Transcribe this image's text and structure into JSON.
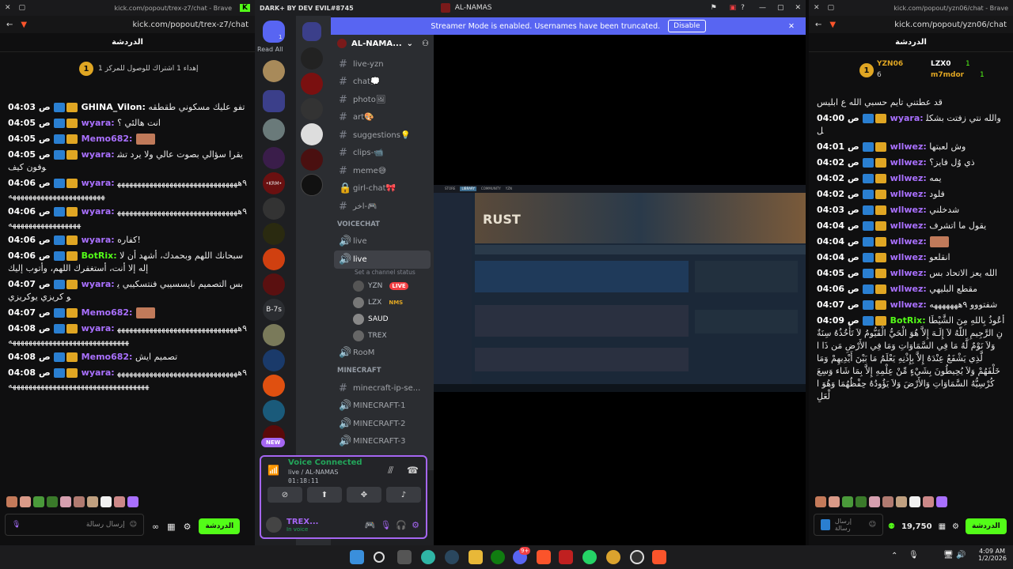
{
  "left_window": {
    "browser_title": "kick.com/popout/trex-z7/chat - Brave",
    "url": "kick.com/popout/trex-z7/chat",
    "tab_label": "الدردشة",
    "pinned_text": "إهداء 1 اشتراك للوصول للمركز 1",
    "pinned_rank": "1",
    "messages": [
      {
        "time": "04:03 ص",
        "user": "GHINA_Vilon:",
        "user_color": "#ffffff",
        "text": "تفو عليك مسكوني طقطقه"
      },
      {
        "time": "04:05 ص",
        "user": "wyara:",
        "user_color": "#a970ff",
        "text": "انت هالئي ؟"
      },
      {
        "time": "04:05 ص",
        "user": "Memo682:",
        "user_color": "#a970ff",
        "text": ""
      },
      {
        "time": "04:05 ص",
        "user": "wyara:",
        "user_color": "#a970ff",
        "text": "يقرا سؤالي بصوت عالي ولا يرد تشوفون كيف"
      },
      {
        "time": "04:06 ص",
        "user": "wyara:",
        "user_color": "#a970ff",
        "text": "٩ههههههههههههههههههههههههههههههههههههههههههههههههههههههه"
      },
      {
        "time": "04:06 ص",
        "user": "wyara:",
        "user_color": "#a970ff",
        "text": "٩ههههههههههههههههههههههههههههههههههههههههههههههههه"
      },
      {
        "time": "04:06 ص",
        "user": "wyara:",
        "user_color": "#a970ff",
        "text": "كفاره!"
      },
      {
        "time": "04:06 ص",
        "user": "BotRix:",
        "user_color": "#53fc18",
        "text": "سبحانك اللهم وبحمدك، أشهد أن لا إله إلا أنت، أستغفرك اللهم، وأتوب إليك"
      },
      {
        "time": "04:07 ص",
        "user": "wyara:",
        "user_color": "#a970ff",
        "text": "بس التصميم نايسسيبي فنتسكيبي يو كريزي يوكريزي"
      },
      {
        "time": "04:07 ص",
        "user": "Memo682:",
        "user_color": "#a970ff",
        "text": ""
      },
      {
        "time": "04:08 ص",
        "user": "wyara:",
        "user_color": "#a970ff",
        "text": "٩ههههههههههههههههههههههههههههههههههههههههههههههههههههههههههههه"
      },
      {
        "time": "04:08 ص",
        "user": "Memo682:",
        "user_color": "#a970ff",
        "text": "تصميم ايش"
      },
      {
        "time": "04:08 ص",
        "user": "wyara:",
        "user_color": "#a970ff",
        "text": "٩هههههههههههههههههههههههههههههههههههههههههههههههههههههههههههههههههه"
      }
    ],
    "input_placeholder": "إرسال رسالة",
    "send_button": "الدردشة"
  },
  "right_window": {
    "browser_title": "kick.com/popout/yzn06/chat - Brave",
    "url": "kick.com/popout/yzn06/chat",
    "tab_label": "الدردشة",
    "leaderboard": [
      {
        "name": "YZN06",
        "count": "6"
      },
      {
        "name": "LZX0",
        "count": "1"
      },
      {
        "name": "m7mdor",
        "count": "1"
      }
    ],
    "leader_rank": "1",
    "messages": [
      {
        "time": "",
        "user": "",
        "user_color": "#ffffff",
        "text": "قد عطتني تايم حسبي الله ع ابليس"
      },
      {
        "time": "04:00 ص",
        "user": "wyara:",
        "user_color": "#a970ff",
        "text": "والله نتي زفتت بشكلل"
      },
      {
        "time": "04:01 ص",
        "user": "wllwez:",
        "user_color": "#a970ff",
        "text": "وش لعبتها"
      },
      {
        "time": "04:02 ص",
        "user": "wllwez:",
        "user_color": "#a970ff",
        "text": "ذي وُل فايز؟"
      },
      {
        "time": "04:02 ص",
        "user": "wllwez:",
        "user_color": "#a970ff",
        "text": "يمه"
      },
      {
        "time": "04:02 ص",
        "user": "wllwez:",
        "user_color": "#a970ff",
        "text": "فلود"
      },
      {
        "time": "04:03 ص",
        "user": "wllwez:",
        "user_color": "#a970ff",
        "text": "شدخلني"
      },
      {
        "time": "04:04 ص",
        "user": "wllwez:",
        "user_color": "#a970ff",
        "text": "يقول ما اتشرف"
      },
      {
        "time": "04:04 ص",
        "user": "wllwez:",
        "user_color": "#a970ff",
        "text": ""
      },
      {
        "time": "04:04 ص",
        "user": "wllwez:",
        "user_color": "#a970ff",
        "text": "انقلعو"
      },
      {
        "time": "04:05 ص",
        "user": "wllwez:",
        "user_color": "#a970ff",
        "text": "الله يعز الاتحاد بس"
      },
      {
        "time": "04:06 ص",
        "user": "wllwez:",
        "user_color": "#a970ff",
        "text": "مقطع البليهي"
      },
      {
        "time": "04:07 ص",
        "user": "wllwez:",
        "user_color": "#a970ff",
        "text": "شفتووو ٩هههههههه"
      },
      {
        "time": "04:09 ص",
        "user": "BotRix:",
        "user_color": "#53fc18",
        "text": "أعُوذُ بِاللهِ مِنَ الشَّيْطَانِ الرَّجِيمِ اللّهُ لاَ إِلَـهَ إِلاَّ هُوَ الْحَيُّ الْقَيُّومُ لاَ تَأْخُذُهُ سِنَةٌ وَلاَ نَوْمٌ لَّهُ مَا فِي السَّمَاوَاتِ وَمَا فِي الأَرْضِ مَن ذَا الَّذِي يَشْفَعُ عِنْدَهُ إِلاَّ بِإِذْنِهِ يَعْلَمُ مَا بَيْنَ أَيْدِيهِمْ وَمَا خَلْفَهُمْ وَلاَ يُحِيطُونَ بِشَيْءٍ مِّنْ عِلْمِهِ إِلاَّ بِمَا شَاء وَسِعَ كُرْسِيُّهُ السَّمَاوَاتِ وَالأَرْضَ وَلاَ يَؤُودُهُ حِفْظُهُمَا وَهُوَ الْعَلِ"
      }
    ],
    "input_placeholder": "إرسال رسالة",
    "points": "19,750",
    "send_button": "الدردشة"
  },
  "discord": {
    "title_left": "DARK+ BY DEV EVIL#8745",
    "title_center": "AL-NAMAS",
    "read_all": "Read All",
    "streamer_banner": "Streamer Mode is enabled. Usernames have been truncated.",
    "disable_button": "Disable",
    "server_name": "AL-NAMA...",
    "channels": [
      {
        "name": "live-yzn",
        "type": "text"
      },
      {
        "name": "chat💭",
        "type": "text"
      },
      {
        "name": "photo🖼",
        "type": "text"
      },
      {
        "name": "art🎨",
        "type": "text"
      },
      {
        "name": "suggestions💡",
        "type": "text"
      },
      {
        "name": "clips-📹",
        "type": "text"
      },
      {
        "name": "meme😅",
        "type": "text"
      },
      {
        "name": "girl-chat🎀",
        "type": "locked"
      },
      {
        "name": "اخر-🎮",
        "type": "text"
      }
    ],
    "voicechat_category": "VOICECHAT",
    "voice_channels": [
      {
        "name": "live"
      },
      {
        "name": "live",
        "status": "Set a channel status"
      }
    ],
    "voice_users": [
      {
        "name": "YZN",
        "tag": "LIVE"
      },
      {
        "name": "LZX",
        "tag": "NMS"
      },
      {
        "name": "SAUD",
        "tag": ""
      },
      {
        "name": "TREX",
        "tag": ""
      }
    ],
    "room_channel": "RooM",
    "minecraft_category": "MINECRAFT",
    "minecraft_channels": [
      "minecraft-ip-se...",
      "MINECRAFT-1",
      "MINECRAFT-2",
      "MINECRAFT-3"
    ],
    "new_badge": "NEW",
    "voice_connected": "Voice Connected",
    "voice_location": "live / AL-NAMAS",
    "voice_timer": "01:18:11",
    "user_name": "TREX...",
    "user_status": "In voice",
    "guild_badges": [
      "1",
      "1",
      "2"
    ],
    "guild_label_b7s": "B-7s",
    "guild_label_krm": "•KRM•"
  },
  "taskbar": {
    "time": "4:09 AM",
    "date": "1/2/2026",
    "discord_badge": "9+"
  },
  "game": {
    "title": "RUST",
    "tab_labels": [
      "STORE",
      "LIBRARY",
      "COMMUNITY",
      "YZN"
    ]
  }
}
